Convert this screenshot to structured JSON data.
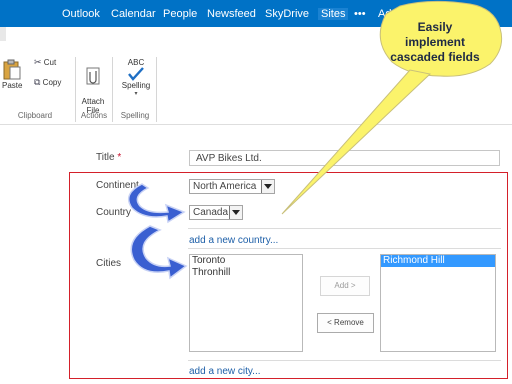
{
  "suite_nav": [
    "Outlook",
    "Calendar",
    "People",
    "Newsfeed",
    "SkyDrive",
    "Sites",
    "•••",
    "Ad"
  ],
  "ribbon": {
    "paste_label": "Paste",
    "cut_label": "Cut",
    "copy_label": "Copy",
    "attach_label": "Attach\nFile",
    "spelling_abc": "ABC",
    "spelling_label": "Spelling",
    "groups": {
      "clipboard": "Clipboard",
      "actions": "Actions",
      "spelling": "Spelling"
    }
  },
  "form": {
    "title_label": "Title",
    "title_required": "*",
    "title_value": "AVP Bikes Ltd.",
    "continent_label": "Continent",
    "continent_value": "North America",
    "country_label": "Country",
    "country_value": "Canada",
    "add_country_link": "add a new country...",
    "cities_label": "Cities",
    "available_cities": [
      "Toronto",
      "Thronhill"
    ],
    "selected_cities": [
      "Richmond Hill"
    ],
    "add_button": "Add >",
    "remove_button": "< Remove",
    "add_city_link": "add a new city..."
  },
  "callout": {
    "line1": "Easily",
    "line2": "implement",
    "line3": "cascaded fields"
  },
  "colors": {
    "suitebar": "#0072c6",
    "callout_fill": "#fbf36b",
    "arrows": "#3a5fd1",
    "highlight_box": "#d4202a"
  }
}
